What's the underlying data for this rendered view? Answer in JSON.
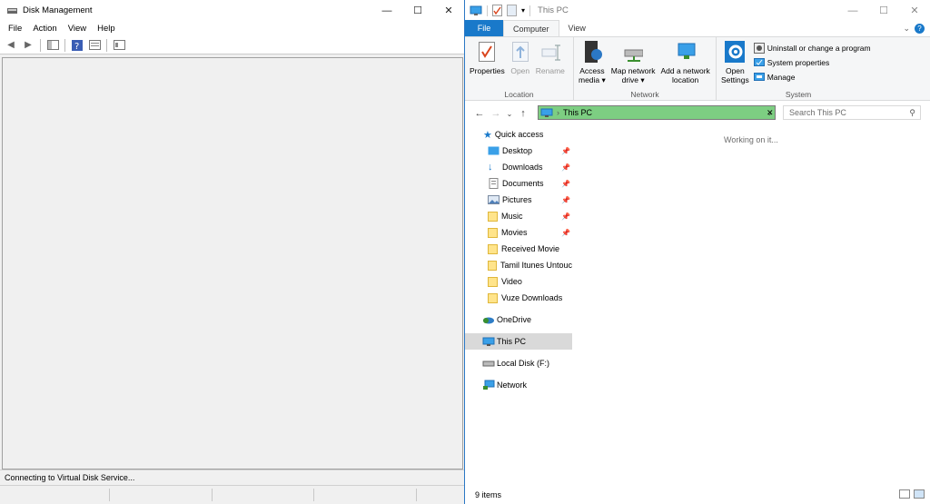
{
  "disk_management": {
    "title": "Disk Management",
    "menu": [
      "File",
      "Action",
      "View",
      "Help"
    ],
    "status": "Connecting to Virtual Disk Service..."
  },
  "explorer": {
    "title": "This PC",
    "tabs": {
      "file": "File",
      "computer": "Computer",
      "view": "View"
    },
    "ribbon": {
      "location": {
        "label": "Location",
        "properties": "Properties",
        "open": "Open",
        "rename": "Rename"
      },
      "network": {
        "label": "Network",
        "access_media_1": "Access",
        "access_media_2": "media",
        "map_drive_1": "Map network",
        "map_drive_2": "drive",
        "add_location_1": "Add a network",
        "add_location_2": "location"
      },
      "system": {
        "label": "System",
        "open_settings_1": "Open",
        "open_settings_2": "Settings",
        "uninstall": "Uninstall or change a program",
        "properties": "System properties",
        "manage": "Manage"
      }
    },
    "address": "This PC",
    "search_placeholder": "Search This PC",
    "working": "Working on it...",
    "nav": {
      "quick_access": "Quick access",
      "pinned": [
        "Desktop",
        "Downloads",
        "Documents",
        "Pictures",
        "Music",
        "Movies"
      ],
      "folders": [
        "Received Movie",
        "Tamil Itunes Untouc",
        "Video",
        "Vuze Downloads"
      ],
      "onedrive": "OneDrive",
      "this_pc": "This PC",
      "local_disk": "Local Disk (F:)",
      "network": "Network"
    },
    "status": "9 items"
  },
  "colors": {
    "accent": "#1979ca",
    "address_highlight": "#7dce82",
    "border": "#2b78c5"
  }
}
